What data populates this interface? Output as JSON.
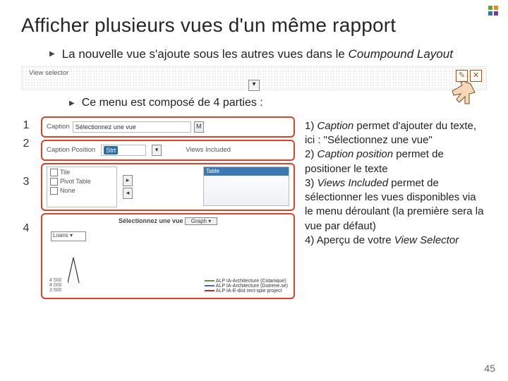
{
  "title": "Afficher plusieurs vues d'un même rapport",
  "bullet1_lead": "La nouvelle vue s'ajoute sous les autres vues dans le ",
  "bullet1_em": "Coumpound Layout",
  "bullet2": "Ce menu est composé de 4 parties :",
  "strip": {
    "label": "View selector",
    "drop": "▾",
    "edit": "✎",
    "close": "✕"
  },
  "nums": {
    "n1": "1",
    "n2": "2",
    "n3": "3",
    "n4": "4"
  },
  "panel": {
    "r1": {
      "lbl": "Caption",
      "val": "Sélectionnez une vue",
      "icon": "M"
    },
    "r2": {
      "lbl1": "Caption Position",
      "sel": "Strt",
      "lbl2": "Views Included"
    },
    "r3": {
      "i1": "Tile",
      "i2": "Pivot Table",
      "i3": "None",
      "t1": "Table"
    },
    "r4": {
      "title": "Sélectionnez une vue",
      "sel": "Graph",
      "axis": [
        "4 500",
        "4 000",
        "3 500"
      ],
      "lg1": "ALP IA-Architecture (Cotanique)",
      "lg2": "ALP IA-Architecture (Dutrene.se)",
      "lg3": "ALP IA-E-dist rect-spie project"
    }
  },
  "desc": {
    "l1a": "1) ",
    "l1b": "Caption",
    "l1c": " permet d'ajouter du texte, ici  : \"Sélectionnez une vue\"",
    "l2a": "2) ",
    "l2b": "Caption position",
    "l2c": " permet de positioner le texte",
    "l3a": "3) ",
    "l3b": "Views Included",
    "l3c": " permet de sélectionner les vues disponibles via le menu déroulant (la première sera la vue par défaut)",
    "l4a": "4) Aperçu de votre ",
    "l4b": "View Selector"
  },
  "page": "45"
}
